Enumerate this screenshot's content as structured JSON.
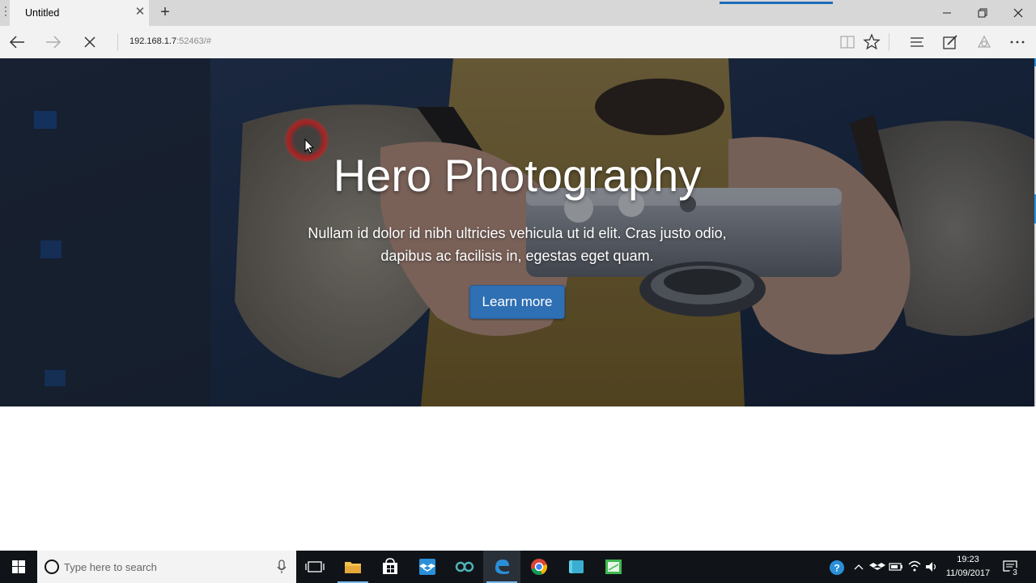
{
  "browser": {
    "tab_title": "Untitled",
    "url_host": "192.168.1.7",
    "url_rest": ":52463/#"
  },
  "hero": {
    "title": "Hero Photography",
    "text": "Nullam id dolor id nibh ultricies vehicula ut id elit. Cras justo odio, dapibus ac facilisis in, egestas eget quam.",
    "button_label": "Learn more"
  },
  "taskbar": {
    "search_placeholder": "Type here to search",
    "time": "19:23",
    "date": "11/09/2017",
    "notification_count": "3"
  },
  "colors": {
    "accent": "#2f6fb3",
    "taskbar": "#101418",
    "tab_strip": "#d7d7d7"
  },
  "icons": [
    "back-icon",
    "forward-icon",
    "stop-icon",
    "reading-view-icon",
    "favorite-star-icon",
    "hub-icon",
    "web-note-icon",
    "share-icon",
    "more-icon",
    "windows-start-icon",
    "task-view-icon",
    "file-explorer-icon",
    "store-icon",
    "dropbox-icon",
    "arduino-icon",
    "edge-icon",
    "chrome-icon",
    "app-icon",
    "sway-icon"
  ]
}
